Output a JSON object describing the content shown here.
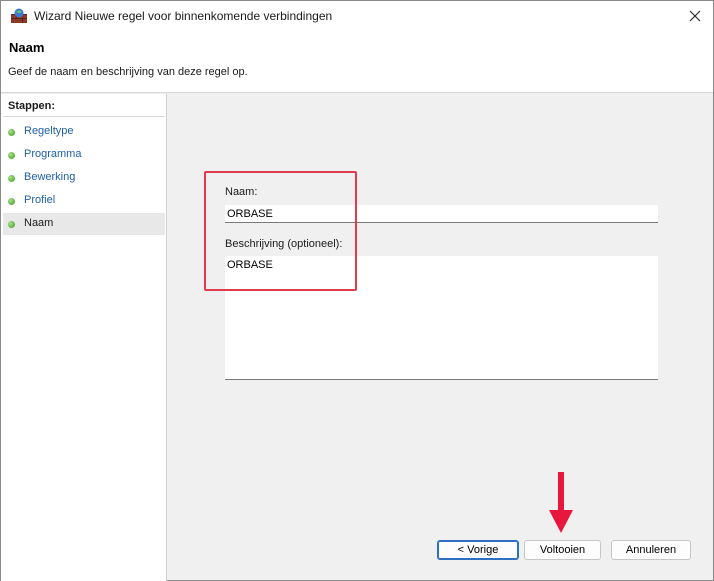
{
  "window": {
    "title": "Wizard Nieuwe regel voor binnenkomende verbindingen",
    "close_icon": "close-icon",
    "app_icon": "firewall-icon"
  },
  "header": {
    "title": "Naam",
    "description": "Geef de naam en beschrijving van deze regel op."
  },
  "steps": {
    "heading": "Stappen:",
    "items": [
      {
        "label": "Regeltype",
        "active": false
      },
      {
        "label": "Programma",
        "active": false
      },
      {
        "label": "Bewerking",
        "active": false
      },
      {
        "label": "Profiel",
        "active": false
      },
      {
        "label": "Naam",
        "active": true
      }
    ]
  },
  "form": {
    "name_label": "Naam:",
    "name_value": "ORBASE",
    "description_label": "Beschrijving (optioneel):",
    "description_value": "ORBASE"
  },
  "buttons": {
    "back": "< Vorige",
    "finish": "Voltooien",
    "cancel": "Annuleren"
  },
  "annotation": {
    "highlight_color": "#e23b4e",
    "arrow_color": "#e8173e"
  }
}
